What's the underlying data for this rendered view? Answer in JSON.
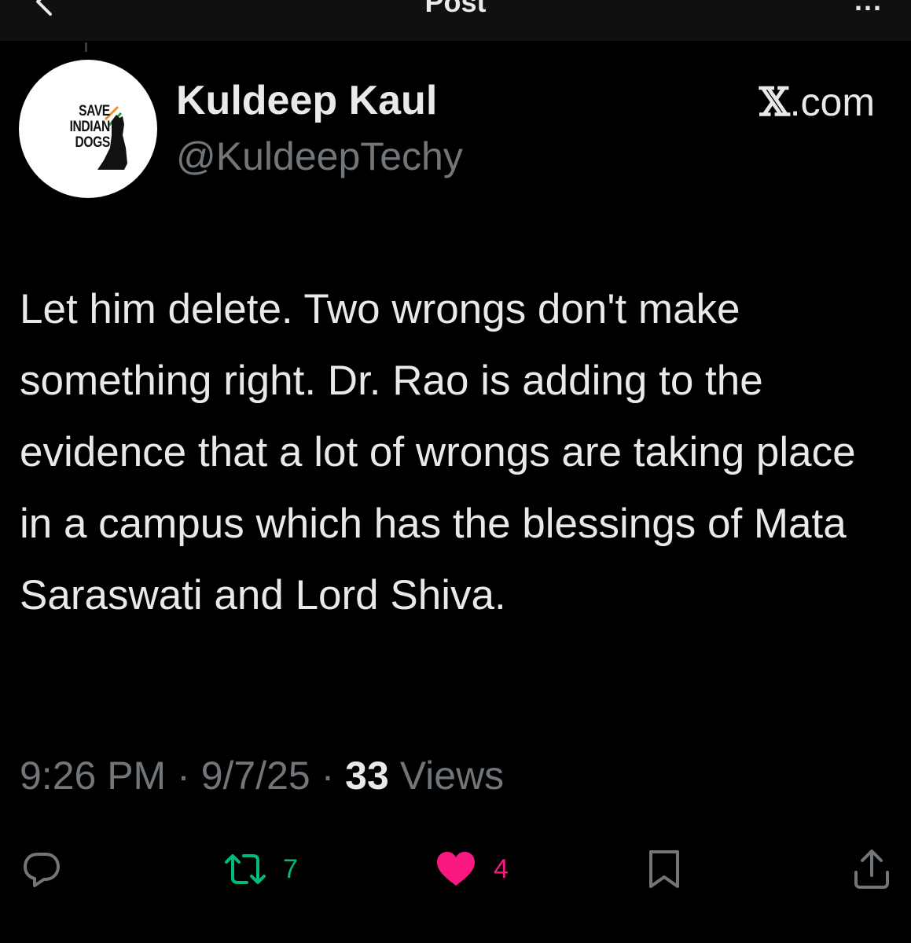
{
  "header": {
    "title": "Post",
    "more_label": "..."
  },
  "post": {
    "author_name": "Kuldeep Kaul",
    "author_handle": "@KuldeepTechy",
    "source_prefix": "𝕏",
    "source_suffix": ".com",
    "avatar_logo_text": "SAVE INDIAN DOGS",
    "text": "Let him delete. Two wrongs don't make something right. Dr. Rao is adding to the evidence that a lot of wrongs are taking place in a campus which has the blessings of Mata Saraswati and Lord Shiva.",
    "time": "9:26 PM",
    "separator": "·",
    "date": "9/7/25",
    "views_count": "33",
    "views_label": "Views"
  },
  "actions": {
    "reply_icon": "reply-icon",
    "repost_icon": "repost-icon",
    "repost_count": "7",
    "like_icon": "heart-icon",
    "like_count": "4",
    "bookmark_icon": "bookmark-icon",
    "share_icon": "share-icon"
  },
  "colors": {
    "background": "#000000",
    "text_primary": "#e7e9ea",
    "text_secondary": "#71767b",
    "repost_green": "#00ba7c",
    "like_pink": "#f91880"
  }
}
